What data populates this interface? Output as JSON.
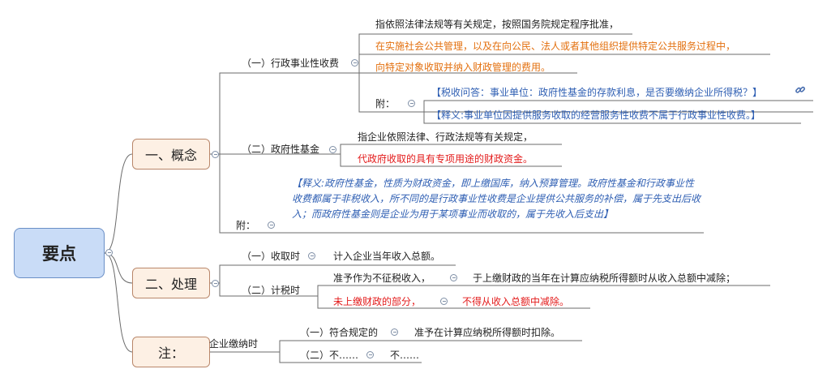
{
  "root": {
    "label": "要点"
  },
  "concept": {
    "label": "一、概念",
    "fee": {
      "label": "（一）行政事业性收费",
      "lines": [
        "指依照法律法规等有关规定，按照国务院规定程序批准，",
        "在实施社会公共管理，以及在向公民、法人或者其他组织提供特定公共服务过程中，",
        "向特定对象收取并纳入财政管理的费用。"
      ],
      "attach_label": "附：",
      "attach_items": [
        "【税收问答：事业单位：政府性基金的存款利息，是否要缴纳企业所得税？】",
        "【释义:事业单位因提供服务收取的经营服务性收费不属于行政事业性收费。】"
      ],
      "link_icon": "link-icon"
    },
    "fund": {
      "label": "（二）政府性基金",
      "lines": [
        "指企业依照法律、行政法规等有关规定，",
        "代政府收取的具有专项用途的财政资金。"
      ]
    },
    "attach": {
      "label": "附：",
      "note": "【释义:政府性基金，性质为财政资金，即上缴国库，纳入预算管理。政府性基金和行政事业性收费都属于非税收入，所不同的是行政事业性收费是企业提供公共服务的补偿，属于先支出后收入；而政府性基金则是企业为用于某项事业而收取的，属于先收入后支出】"
    }
  },
  "handling": {
    "label": "二、处理",
    "receive": {
      "label": "（一）收取时",
      "text": "计入企业当年收入总额。"
    },
    "tax": {
      "label": "（二）计税时",
      "row1": {
        "label": "准予作为不征税收入，",
        "text": "于上缴财政的当年在计算应纳税所得额时从收入总额中减除；"
      },
      "row2": {
        "label": "未上缴财政的部分，",
        "text": "不得从收入总额中减除。"
      }
    }
  },
  "note": {
    "label": "注：",
    "branch": "企业缴纳时",
    "items": [
      {
        "label": "（一）符合规定的",
        "text": "准予在计算应纳税所得额时扣除。"
      },
      {
        "label": "（二）不……",
        "text": "不……"
      }
    ]
  },
  "colors": {
    "root_fill": "#c9dcf7",
    "main_fill": "#fdf0e4",
    "orange": "#e3700f",
    "red": "#e31b1b",
    "blue": "#2f5fb3",
    "line": "#6b6b6b"
  }
}
